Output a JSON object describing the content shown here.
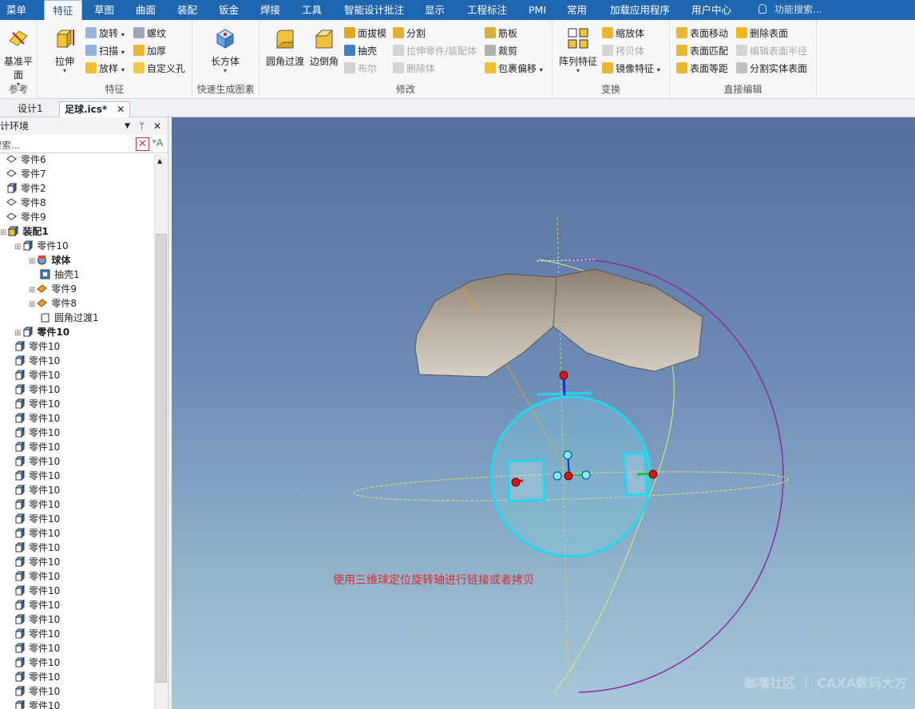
{
  "menubar": {
    "tabs": [
      "菜单",
      "特征",
      "草图",
      "曲面",
      "装配",
      "钣金",
      "焊接",
      "工具",
      "智能设计批注",
      "显示",
      "工程标注",
      "PMI",
      "常用",
      "加载应用程序",
      "用户中心"
    ],
    "active": "特征",
    "search": "功能搜索..."
  },
  "ribbon": {
    "ref": {
      "label": "参考",
      "base_plane": "基准平面"
    },
    "feature": {
      "label": "特征",
      "extrude": "拉伸",
      "revolve": "旋转",
      "sweep": "扫描",
      "loft": "放样",
      "thread": "螺纹",
      "thicken": "加厚",
      "custom_hole": "自定义孔"
    },
    "quick": {
      "label": "快速生成图素",
      "box": "长方体"
    },
    "modify": {
      "label": "修改",
      "fillet": "圆角过渡",
      "chamfer": "边倒角",
      "draft": "面拔模",
      "shell": "抽壳",
      "boolean": "布尔",
      "split": "分割",
      "stretch": "拉伸零件/装配体",
      "delete_body": "删除体",
      "rib": "筋板",
      "trim": "裁剪",
      "wrap_offset": "包裹偏移"
    },
    "transform": {
      "label": "变换",
      "pattern": "阵列特征",
      "scale": "缩放体",
      "copy": "拷贝体",
      "mirror": "镜像特征"
    },
    "direct": {
      "label": "直接编辑",
      "face_move": "表面移动",
      "face_match": "表面匹配",
      "face_offset": "表面等距",
      "delete_face": "删除表面",
      "edit_radius": "编辑表面半径",
      "split_face": "分割实体表面"
    }
  },
  "doctabs": {
    "tab1": "设计1",
    "tab2": "足球.ics*"
  },
  "panel": {
    "title": "设计环境",
    "search_placeholder": "搜索...",
    "tree": [
      {
        "label": "零件6",
        "bold": false
      },
      {
        "label": "零件7",
        "bold": false
      },
      {
        "label": "零件2",
        "bold": false
      },
      {
        "label": "零件8",
        "bold": false
      },
      {
        "label": "零件9",
        "bold": false
      },
      {
        "label": "装配1",
        "bold": true
      },
      {
        "label": "零件10",
        "bold": false
      },
      {
        "label": "球体",
        "bold": true
      },
      {
        "label": "抽壳1",
        "bold": false
      },
      {
        "label": "零件9",
        "bold": false
      },
      {
        "label": "零件8",
        "bold": false
      },
      {
        "label": "圆角过渡1",
        "bold": false
      },
      {
        "label": "零件10",
        "bold": true
      },
      {
        "label": "零件10",
        "bold": false
      },
      {
        "label": "零件10",
        "bold": false
      },
      {
        "label": "零件10",
        "bold": false
      },
      {
        "label": "零件10",
        "bold": false
      },
      {
        "label": "零件10",
        "bold": false
      },
      {
        "label": "零件10",
        "bold": false
      },
      {
        "label": "零件10",
        "bold": false
      },
      {
        "label": "零件10",
        "bold": false
      },
      {
        "label": "零件10",
        "bold": false
      },
      {
        "label": "零件10",
        "bold": false
      },
      {
        "label": "零件10",
        "bold": false
      },
      {
        "label": "零件10",
        "bold": false
      },
      {
        "label": "零件10",
        "bold": false
      },
      {
        "label": "零件10",
        "bold": false
      },
      {
        "label": "零件10",
        "bold": false
      },
      {
        "label": "零件10",
        "bold": false
      },
      {
        "label": "零件10",
        "bold": false
      },
      {
        "label": "零件10",
        "bold": false
      },
      {
        "label": "零件10",
        "bold": false
      },
      {
        "label": "零件10",
        "bold": false
      },
      {
        "label": "零件10",
        "bold": false
      },
      {
        "label": "零件10",
        "bold": false
      },
      {
        "label": "零件10",
        "bold": false
      },
      {
        "label": "零件10",
        "bold": false
      },
      {
        "label": "零件10",
        "bold": false
      },
      {
        "label": "零件10",
        "bold": false
      },
      {
        "label": "零件10",
        "bold": false
      },
      {
        "label": "零件10",
        "bold": false
      }
    ]
  },
  "viewport": {
    "hint": "使用三维球定位旋转轴进行链接或者拷贝",
    "watermark": "咖嘿社区 ｜ CAXA数码大方"
  },
  "colors": {
    "menubar": "#1e66b0",
    "hint": "#e0282f",
    "ball": "#22d8ee"
  }
}
